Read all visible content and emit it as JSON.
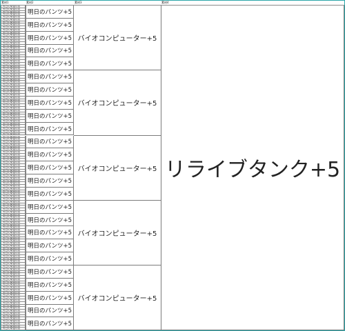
{
  "headers": [
    "素材1",
    "素材2",
    "素材3",
    "素材4"
  ],
  "tier1_label": "昨日の幸運の羽",
  "tier2_label": "明日のパンツ+5",
  "tier3_label": "バイオコンピューター+5",
  "tier4_label": "リライブタンク+5",
  "layout": {
    "groups": 5,
    "tier2_per_group": 5,
    "tier1_per_tier2": 5
  }
}
